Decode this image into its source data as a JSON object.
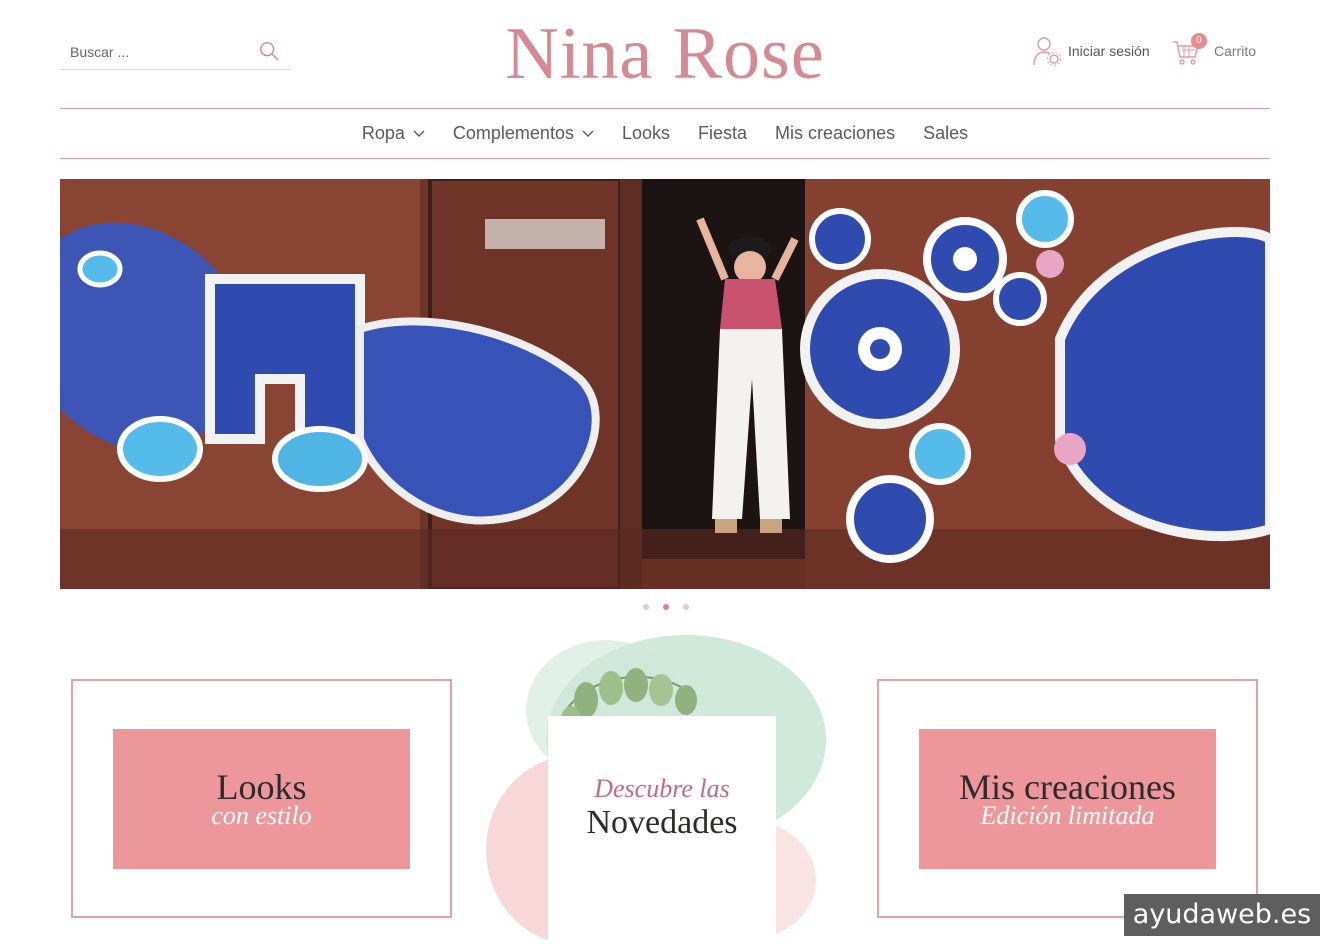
{
  "header": {
    "search_placeholder": "Buscar ...",
    "logo": "Nina Rose",
    "login_label": "Iniciar sesión",
    "cart_count": "0",
    "cart_label": "Carrito"
  },
  "nav": {
    "items": [
      {
        "label": "Ropa",
        "has_dropdown": true
      },
      {
        "label": "Complementos",
        "has_dropdown": true
      },
      {
        "label": "Looks",
        "has_dropdown": false
      },
      {
        "label": "Fiesta",
        "has_dropdown": false
      },
      {
        "label": "Mis creaciones",
        "has_dropdown": false
      },
      {
        "label": "Sales",
        "has_dropdown": false
      }
    ]
  },
  "slider": {
    "slide_count": 3,
    "active_index": 1
  },
  "promos": {
    "looks": {
      "title": "Looks",
      "subtitle": "con estilo"
    },
    "novedades": {
      "line1": "Descubre las",
      "line2": "Novedades"
    },
    "creaciones": {
      "title": "Mis creaciones",
      "subtitle": "Edición limitada"
    }
  },
  "watermark": "ayudaweb.es",
  "colors": {
    "brand_pink": "#d58a91",
    "promo_pink": "#ee979b",
    "border_pink": "#e3a1a6"
  }
}
